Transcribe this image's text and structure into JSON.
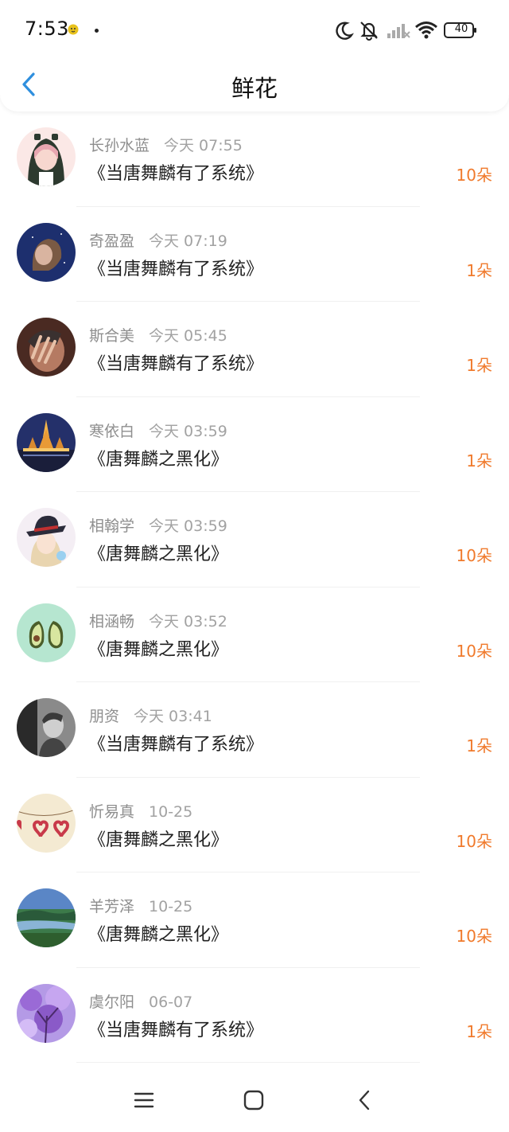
{
  "status_bar": {
    "time": "7:53",
    "battery": "40",
    "icons": [
      "notification-bird-icon",
      "moon-icon",
      "bell-mute-icon",
      "signal-icon",
      "wifi-icon",
      "battery-icon"
    ]
  },
  "header": {
    "title": "鲜花",
    "back_icon": "chevron-left-icon",
    "accent_color": "#2f8fde"
  },
  "colors": {
    "count": "#f07a2c",
    "meta": "#8e8e8e",
    "title": "#222222"
  },
  "items": [
    {
      "name": "长孙水蓝",
      "time": "今天 07:55",
      "book": "《当唐舞麟有了系统》",
      "count": "10朵",
      "avatar": "anime-girl-avatar"
    },
    {
      "name": "奇盈盈",
      "time": "今天 07:19",
      "book": "《当唐舞麟有了系统》",
      "count": "1朵",
      "avatar": "night-portrait-avatar"
    },
    {
      "name": "斯合美",
      "time": "今天 05:45",
      "book": "《当唐舞麟有了系统》",
      "count": "1朵",
      "avatar": "hand-face-avatar"
    },
    {
      "name": "寒依白",
      "time": "今天 03:59",
      "book": "《唐舞麟之黑化》",
      "count": "1朵",
      "avatar": "temple-night-avatar"
    },
    {
      "name": "相翰学",
      "time": "今天 03:59",
      "book": "《唐舞麟之黑化》",
      "count": "10朵",
      "avatar": "anime-hat-avatar"
    },
    {
      "name": "相涵畅",
      "time": "今天 03:52",
      "book": "《唐舞麟之黑化》",
      "count": "10朵",
      "avatar": "avocado-avatar"
    },
    {
      "name": "朋资",
      "time": "今天 03:41",
      "book": "《当唐舞麟有了系统》",
      "count": "1朵",
      "avatar": "bw-portrait-avatar"
    },
    {
      "name": "忻易真",
      "time": "10-25",
      "book": "《唐舞麟之黑化》",
      "count": "10朵",
      "avatar": "hearts-avatar"
    },
    {
      "name": "羊芳泽",
      "time": "10-25",
      "book": "《唐舞麟之黑化》",
      "count": "10朵",
      "avatar": "landscape-avatar"
    },
    {
      "name": "虞尔阳",
      "time": "06-07",
      "book": "《当唐舞麟有了系统》",
      "count": "1朵",
      "avatar": "purple-blossom-avatar"
    }
  ],
  "nav": {
    "icons": [
      "menu-icon",
      "home-icon",
      "back-icon"
    ]
  }
}
